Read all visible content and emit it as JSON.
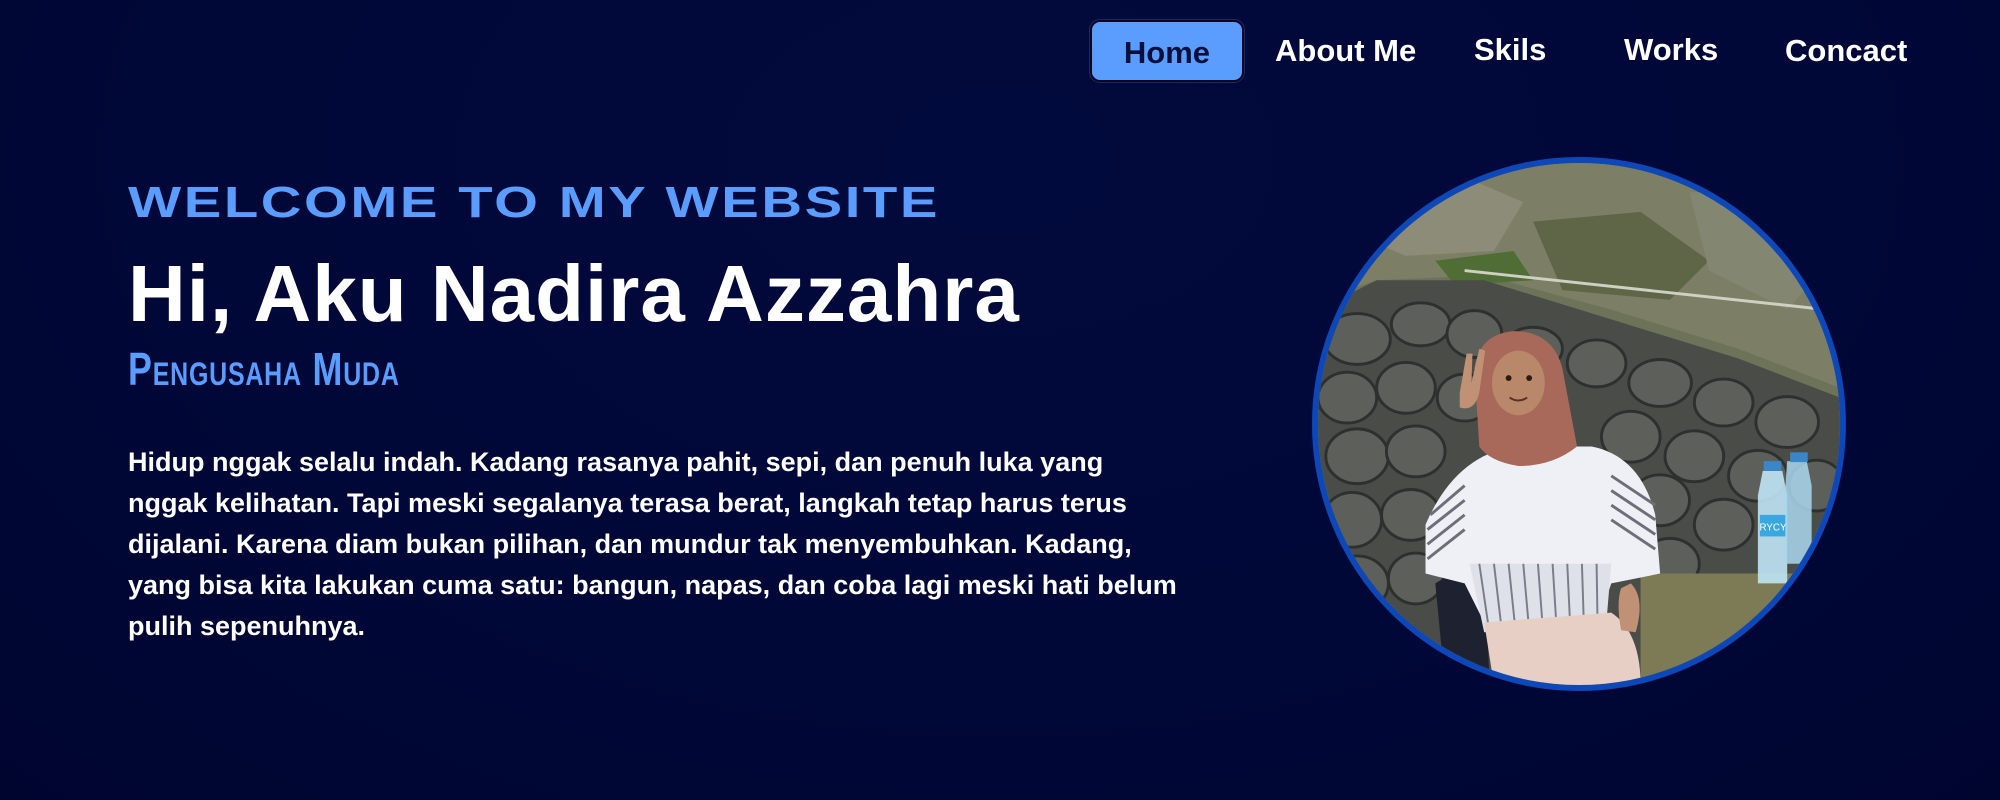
{
  "nav": {
    "items": [
      {
        "label": "Home",
        "active": true
      },
      {
        "label": "About Me"
      },
      {
        "label": "Skils"
      },
      {
        "label": "Works"
      },
      {
        "label": "Concact"
      }
    ]
  },
  "hero": {
    "welcome": "WELCOME TO MY WEBSITE",
    "title": "Hi, Aku Nadira Azzahra",
    "role": "Pengusaha Muda",
    "bio": "Hidup nggak selalu indah. Kadang rasanya pahit, sepi, dan penuh luka yang nggak kelihatan. Tapi meski segalanya terasa berat, langkah tetap harus terus dijalani. Karena diam bukan pilihan, dan mundur tak menyembuhkan. Kadang, yang bisa kita lakukan cuma satu: bangun, napas, dan coba lagi meski hati belum pulih sepenuhnya."
  },
  "colors": {
    "background": "#000838",
    "accent": "#5b9cff",
    "photo_border": "#0d47b8",
    "text": "#ffffff"
  },
  "photo": {
    "bottle_label": "RYCY"
  }
}
